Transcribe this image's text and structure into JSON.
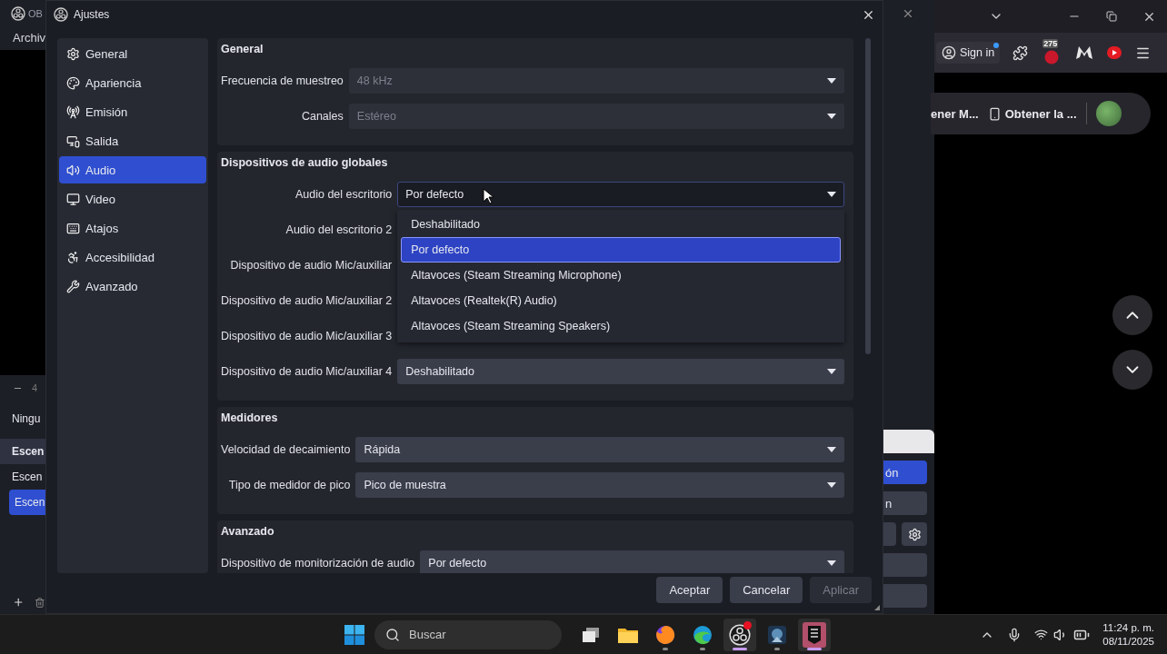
{
  "background_window": {
    "title": "OB",
    "menu": [
      "Archiv"
    ],
    "mixer_value": "4",
    "source_empty": "Ningu",
    "scenes_header": "Escen",
    "scenes": [
      {
        "label": "Escen",
        "selected": false
      },
      {
        "label": "Escen",
        "selected": true
      }
    ],
    "side_buttons": [
      {
        "kind": "primary",
        "label": "ón"
      },
      {
        "kind": "plain",
        "label": "n"
      },
      {
        "kind": "settings"
      },
      {
        "kind": "plain"
      },
      {
        "kind": "plain"
      }
    ]
  },
  "dialog": {
    "title": "Ajustes",
    "nav": [
      {
        "label": "General",
        "selected": false
      },
      {
        "label": "Apariencia",
        "selected": false
      },
      {
        "label": "Emisión",
        "selected": false
      },
      {
        "label": "Salida",
        "selected": false
      },
      {
        "label": "Audio",
        "selected": true
      },
      {
        "label": "Video",
        "selected": false
      },
      {
        "label": "Atajos",
        "selected": false
      },
      {
        "label": "Accesibilidad",
        "selected": false
      },
      {
        "label": "Avanzado",
        "selected": false
      }
    ],
    "sections": [
      {
        "title": "General",
        "rows": [
          {
            "label": "Frecuencia de muestreo",
            "value": "48 kHz",
            "disabled": true
          },
          {
            "label": "Canales",
            "value": "Estéreo",
            "disabled": true
          }
        ]
      },
      {
        "title": "Dispositivos de audio globales",
        "rows": [
          {
            "label": "Audio del escritorio",
            "value": "Por defecto",
            "disabled": false,
            "open": true,
            "options": [
              {
                "label": "Deshabilitado",
                "selected": false
              },
              {
                "label": "Por defecto",
                "selected": true
              },
              {
                "label": "Altavoces (Steam Streaming Microphone)",
                "selected": false
              },
              {
                "label": "Altavoces (Realtek(R) Audio)",
                "selected": false
              },
              {
                "label": "Altavoces (Steam Streaming Speakers)",
                "selected": false
              }
            ]
          },
          {
            "label": "Audio del escritorio 2"
          },
          {
            "label": "Dispositivo de audio Mic/auxiliar"
          },
          {
            "label": "Dispositivo de audio Mic/auxiliar 2"
          },
          {
            "label": "Dispositivo de audio Mic/auxiliar 3"
          },
          {
            "label": "Dispositivo de audio Mic/auxiliar 4",
            "value": "Deshabilitado",
            "disabled": false
          }
        ]
      },
      {
        "title": "Medidores",
        "rows": [
          {
            "label": "Velocidad de decaimiento",
            "value": "Rápida",
            "disabled": false
          },
          {
            "label": "Tipo de medidor de pico",
            "value": "Pico de muestra",
            "disabled": false
          }
        ]
      },
      {
        "title": "Avanzado",
        "rows": [
          {
            "label": "Dispositivo de monitorización de audio",
            "value": "Por defecto",
            "disabled": false
          }
        ]
      }
    ],
    "buttons": [
      {
        "label": "Aceptar",
        "disabled": false
      },
      {
        "label": "Cancelar",
        "disabled": false
      },
      {
        "label": "Aplicar",
        "disabled": true
      }
    ]
  },
  "browser": {
    "sign_in": "Sign in",
    "badge": "275",
    "bookmarks": [
      "ener M...",
      "Obtener la ..."
    ]
  },
  "taskbar": {
    "search": {
      "placeholder": "Buscar"
    },
    "apps": [
      {
        "kind": "taskview",
        "running": false,
        "active": false
      },
      {
        "kind": "folder",
        "running": false,
        "active": false
      },
      {
        "kind": "firefox",
        "running": true,
        "active": false
      },
      {
        "kind": "edge",
        "running": true,
        "active": false
      },
      {
        "kind": "obs",
        "running": true,
        "active": true,
        "notification": true
      },
      {
        "kind": "game",
        "running": true,
        "active": false
      },
      {
        "kind": "epic",
        "running": true,
        "active": true
      }
    ],
    "time": "11:24 p. m.",
    "date": "08/11/2025"
  }
}
